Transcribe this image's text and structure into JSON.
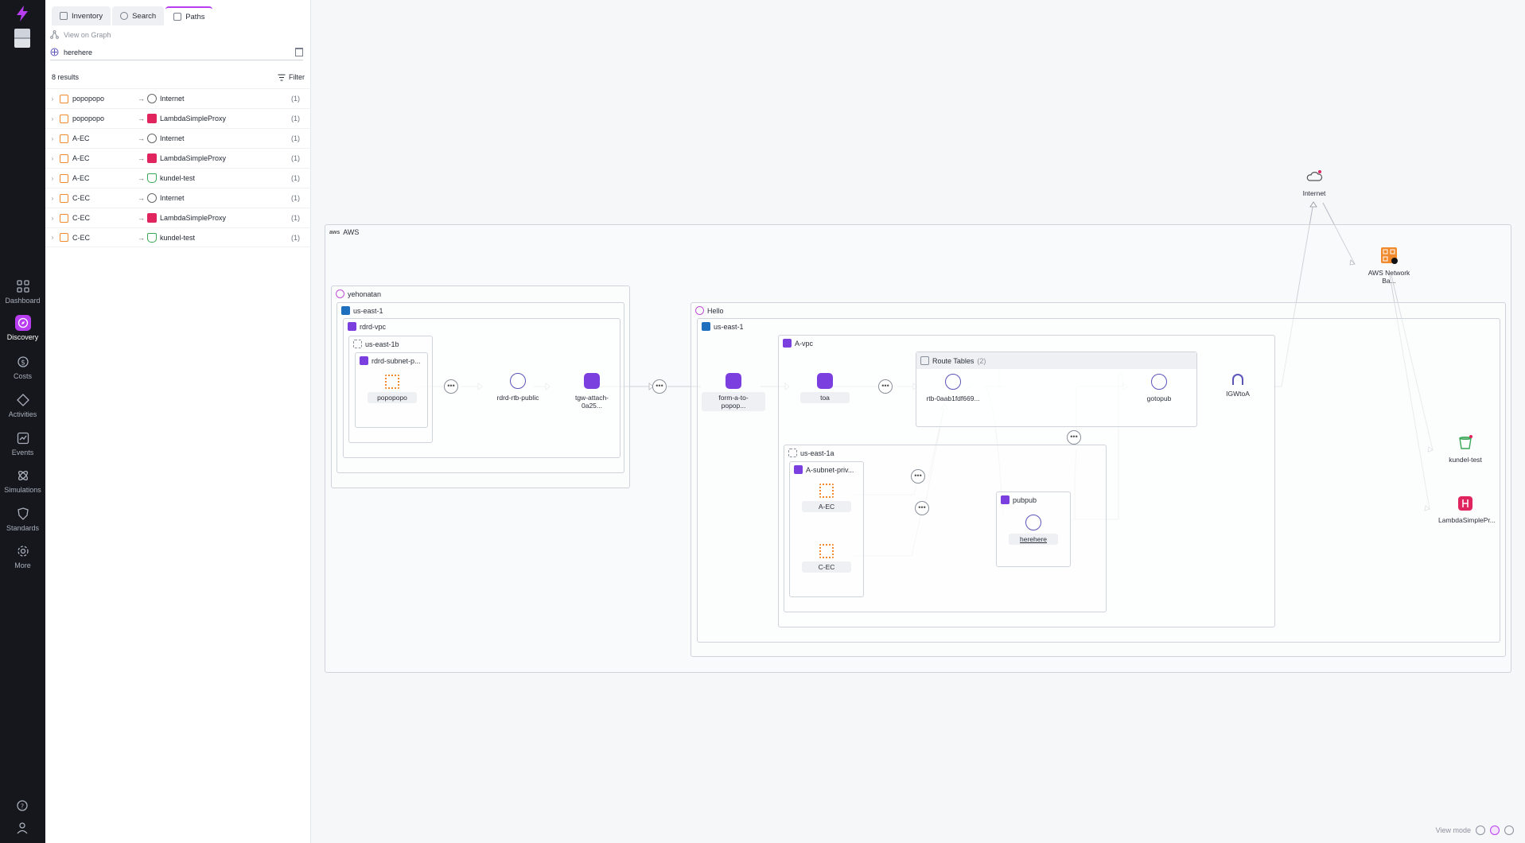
{
  "nav": {
    "items": [
      {
        "label": "Dashboard",
        "icon": "grid-icon"
      },
      {
        "label": "Discovery",
        "icon": "compass-icon",
        "active": true
      },
      {
        "label": "Costs",
        "icon": "dollar-icon"
      },
      {
        "label": "Activities",
        "icon": "activities-icon"
      },
      {
        "label": "Events",
        "icon": "events-icon"
      },
      {
        "label": "Simulations",
        "icon": "simulations-icon"
      },
      {
        "label": "Standards",
        "icon": "shield-icon"
      },
      {
        "label": "More",
        "icon": "gear-icon"
      }
    ]
  },
  "tabs": {
    "inventory": "Inventory",
    "search": "Search",
    "paths": "Paths"
  },
  "panel": {
    "view_on_graph": "View on Graph",
    "path_value": "herehere",
    "results_count": "8 results",
    "filter_label": "Filter",
    "rows": [
      {
        "src": "popopopo",
        "dst": "Internet",
        "dst_kind": "internet",
        "count": "(1)"
      },
      {
        "src": "popopopo",
        "dst": "LambdaSimpleProxy",
        "dst_kind": "lambda",
        "count": "(1)"
      },
      {
        "src": "A-EC",
        "dst": "Internet",
        "dst_kind": "internet",
        "count": "(1)"
      },
      {
        "src": "A-EC",
        "dst": "LambdaSimpleProxy",
        "dst_kind": "lambda",
        "count": "(1)"
      },
      {
        "src": "A-EC",
        "dst": "kundel-test",
        "dst_kind": "bucket",
        "count": "(1)"
      },
      {
        "src": "C-EC",
        "dst": "Internet",
        "dst_kind": "internet",
        "count": "(1)"
      },
      {
        "src": "C-EC",
        "dst": "LambdaSimpleProxy",
        "dst_kind": "lambda",
        "count": "(1)"
      },
      {
        "src": "C-EC",
        "dst": "kundel-test",
        "dst_kind": "bucket",
        "count": "(1)"
      }
    ]
  },
  "graph": {
    "aws": "AWS",
    "acct_yehonatan": "yehonatan",
    "acct_hello": "Hello",
    "region_left": "us-east-1",
    "region_right": "us-east-1",
    "rdrd_vpc": "rdrd-vpc",
    "az_1b": "us-east-1b",
    "rdrd_subnet": "rdrd-subnet-p...",
    "a_vpc": "A-vpc",
    "route_tables": "Route Tables",
    "route_tables_count": "(2)",
    "az_1a": "us-east-1a",
    "a_subnet": "A-subnet-priv...",
    "pubpub": "pubpub",
    "nodes": {
      "popopopo": "popopopo",
      "rdrd_rtb": "rdrd-rtb-public",
      "tgw": "tgw-attach-0a25...",
      "form": "form-a-to-popop...",
      "toa": "toa",
      "rtb": "rtb-0aab1fdf669...",
      "gotopub": "gotopub",
      "igw": "IGWtoA",
      "aec": "A-EC",
      "cec": "C-EC",
      "herehere": "herehere",
      "internet": "Internet",
      "netba": "AWS Network Ba...",
      "kundel": "kundel-test",
      "lambda": "LambdaSimplePr..."
    },
    "view_mode": "View mode"
  },
  "colors": {
    "accent": "#b83df0",
    "vpc": "#7b3fe0",
    "region": "#1f6fbf",
    "ec2": "#f08a2c",
    "lambda": "#e0245e",
    "bucket": "#3aa856"
  }
}
